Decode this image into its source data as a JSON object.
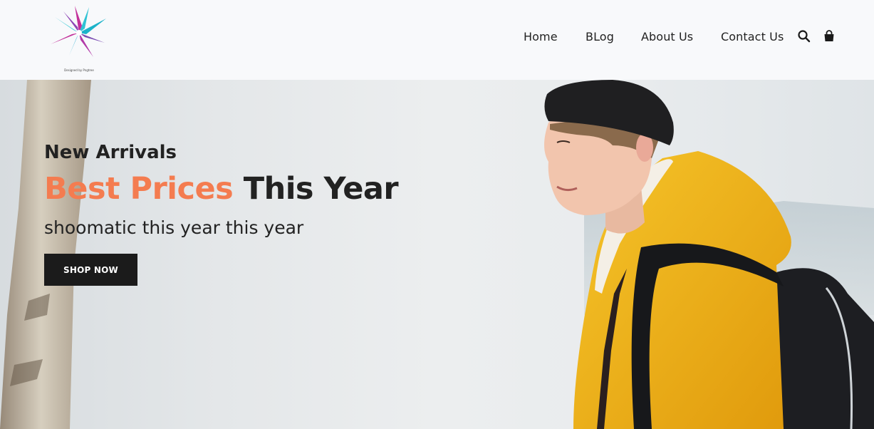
{
  "header": {
    "logo_caption": "Designed by Pngtree",
    "nav": [
      {
        "label": "Home"
      },
      {
        "label": "BLog"
      },
      {
        "label": "About Us"
      },
      {
        "label": "Contact Us"
      }
    ],
    "icons": [
      "search-icon",
      "shopping-bag-icon"
    ]
  },
  "hero": {
    "kicker": "New Arrivals",
    "title_accent": "Best Prices",
    "title_rest": "This Year",
    "subtitle": "shoomatic this year this year",
    "cta_label": "SHOP NOW"
  },
  "colors": {
    "accent": "#f47c50",
    "text": "#222222",
    "button_bg": "#1b1b1b",
    "header_bg": "#f8f9fb",
    "jacket": "#f2b51d"
  }
}
